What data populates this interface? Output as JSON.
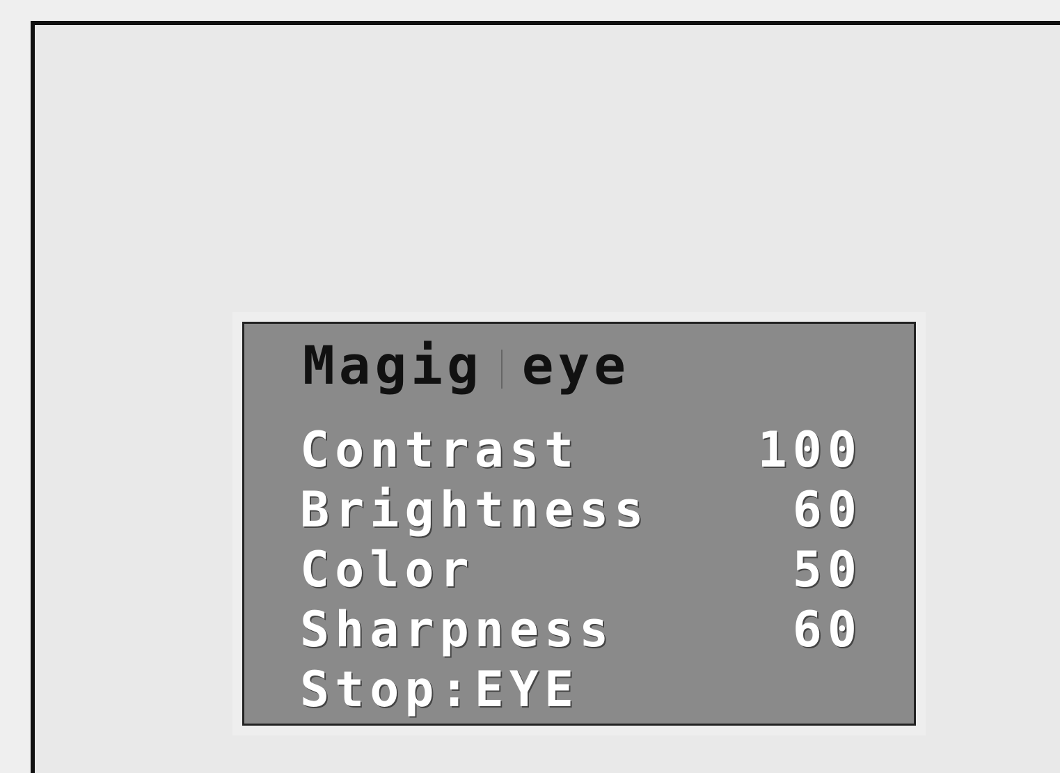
{
  "osd": {
    "title_part1": "Magig",
    "title_part2": "eye",
    "items": [
      {
        "label": "Contrast",
        "value": "100"
      },
      {
        "label": "Brightness",
        "value": "60"
      },
      {
        "label": "Color",
        "value": "50"
      },
      {
        "label": "Sharpness",
        "value": "60"
      }
    ],
    "stop_hint": "Stop:EYE"
  },
  "colors": {
    "panel_bg": "#8a8a8a",
    "panel_border": "#222222",
    "text": "#ffffff",
    "title_text": "#111111",
    "screen_bg": "#e9e9e9"
  }
}
